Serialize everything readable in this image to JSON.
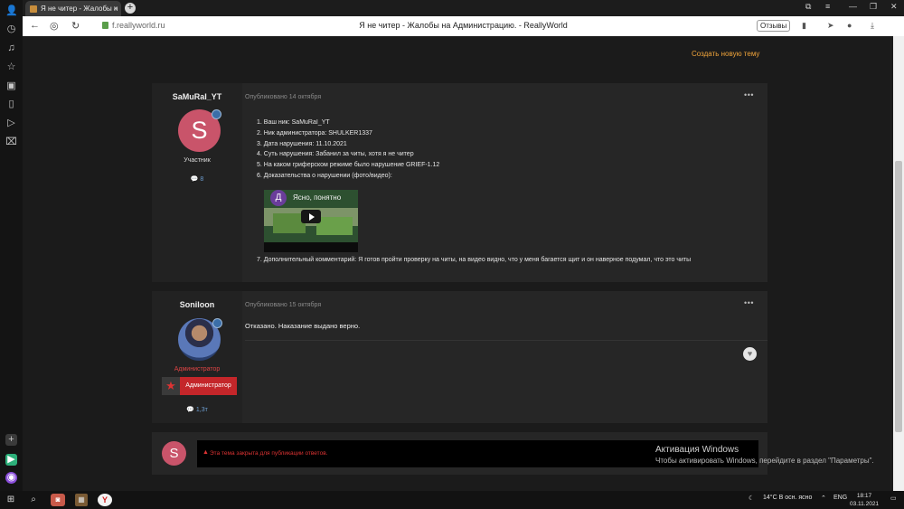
{
  "browser": {
    "tab_title": "Я не читер - Жалобы н",
    "tab_close": "×",
    "new_tab": "+",
    "url": "f.reallyworld.ru",
    "page_title": "Я не читер - Жалобы на Администрацию. - ReallyWorld",
    "reviews_label": "Отзывы"
  },
  "page": {
    "create_topic": "Создать новую тему",
    "posts": [
      {
        "author": "SaMuRaI_YT",
        "avatar_letter": "S",
        "role": "Участник",
        "post_count": "8",
        "date": "Опубликовано 14 октября",
        "lines": [
          "1. Ваш ник: SaMuRaI_YT",
          "2. Ник администратора: SHULKER1337",
          "3. Дата нарушения: 11.10.2021",
          "4. Суть нарушения: Забанил за читы, хотя я не читер",
          "5. На каком гриферском режиме было нарушение GRIEF-1.12",
          "6. Доказательства о нарушении (фото/видео):"
        ],
        "video": {
          "channel_letter": "Д",
          "title": "Ясно, понятно"
        },
        "comment": "7. Дополнительный комментарий: Я готов пройти проверку на читы, на видео видно, что у меня багается щит и он наверное  подумал, что это читы"
      },
      {
        "author": "Soniloon",
        "role": "Администратор",
        "role_badge": "Администратор",
        "post_count": "1,3т",
        "date": "Опубликовано 15 октября",
        "text": "Отказано. Наказание выдано верно."
      }
    ],
    "closed": {
      "avatar_letter": "S",
      "warn_icon": "▲",
      "text": "Эта тема закрыта для публикации ответов."
    },
    "activation": {
      "title": "Активация Windows",
      "subtitle": "Чтобы активировать Windows, перейдите в раздел \"Параметры\"."
    }
  },
  "taskbar": {
    "weather": "14°C  В осн. ясно",
    "lang": "ENG",
    "time": "18:17",
    "date": "03.11.2021"
  }
}
